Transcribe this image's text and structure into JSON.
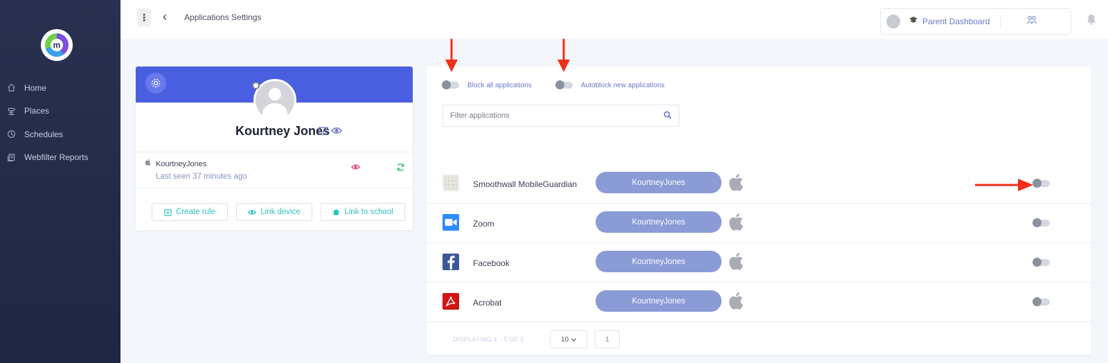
{
  "sidebar": {
    "logo_letter": "m",
    "items": [
      {
        "label": "Home",
        "icon": "home-icon"
      },
      {
        "label": "Places",
        "icon": "places-icon"
      },
      {
        "label": "Schedules",
        "icon": "clock-icon"
      },
      {
        "label": "Webfilter Reports",
        "icon": "report-icon"
      }
    ]
  },
  "topbar": {
    "menu_glyph": "⋮",
    "back_glyph": "‹",
    "title": "Applications Settings",
    "dashboard_label": "Parent Dashboard"
  },
  "profile": {
    "name": "Kourtney Jones",
    "device": {
      "name": "KourtneyJones",
      "last_seen": "Last seen 37 minutes ago"
    },
    "buttons": {
      "create_rule": "Create rule",
      "link_device": "Link device",
      "link_school": "Link to school"
    }
  },
  "apps": {
    "block_all_label": "Block all applications",
    "autoblock_label": "Autoblock new applications",
    "filter_placeholder": "Filter applications",
    "rows": [
      {
        "name": "Smoothwall MobileGuardian",
        "user": "KourtneyJones",
        "icon": "mobileguardian-icon",
        "enabled": false
      },
      {
        "name": "Zoom",
        "user": "KourtneyJones",
        "icon": "zoom-icon",
        "enabled": false
      },
      {
        "name": "Facebook",
        "user": "KourtneyJones",
        "icon": "facebook-icon",
        "enabled": false
      },
      {
        "name": "Acrobat",
        "user": "KourtneyJones",
        "icon": "acrobat-icon",
        "enabled": false
      }
    ],
    "footer": {
      "displaying": "DISPLAYING 1 - 5 OF 5",
      "per_page": "10",
      "page": "1"
    }
  },
  "colors": {
    "sidebar_bg": "#242a48",
    "banner": "#4a5fe0",
    "user_pill": "#8a9bd6",
    "accent_teal": "#2ec4c0",
    "annotation_arrow": "#f02e1a"
  }
}
